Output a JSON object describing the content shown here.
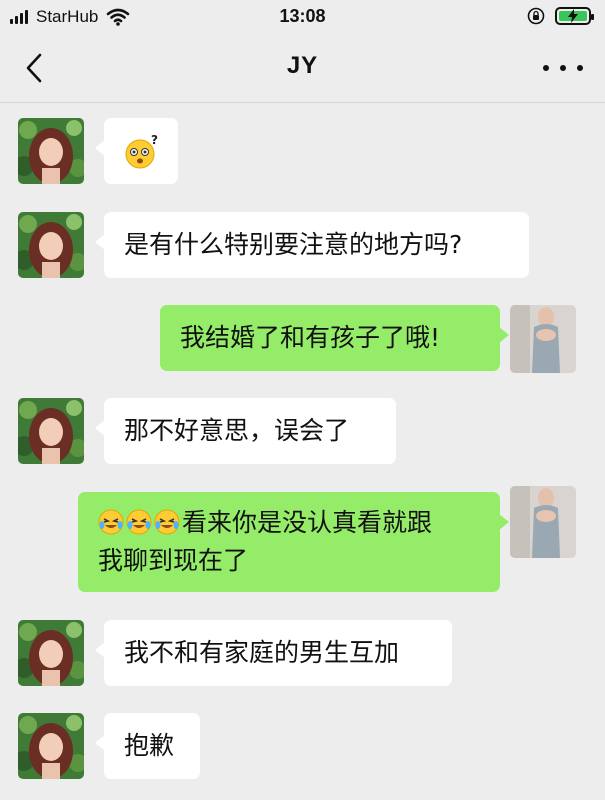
{
  "status_bar": {
    "carrier": "StarHub",
    "time": "13:08",
    "icons": [
      "signal-icon",
      "wifi-icon",
      "orientation-lock-icon",
      "battery-charging-icon"
    ]
  },
  "header": {
    "title": "JY",
    "back_icon": "chevron-left-icon",
    "more_icon": "more-dots-icon"
  },
  "messages": [
    {
      "side": "left",
      "sender": "JY",
      "content": "",
      "emoji": [
        "flushed-question-emoji"
      ]
    },
    {
      "side": "left",
      "sender": "JY",
      "content": "是有什么特别要注意的地方吗?"
    },
    {
      "side": "right",
      "sender": "me",
      "content": "我结婚了和有孩子了哦!"
    },
    {
      "side": "left",
      "sender": "JY",
      "content": "那不好意思，误会了"
    },
    {
      "side": "right",
      "sender": "me",
      "emoji": [
        "crying-laughing-emoji",
        "crying-laughing-emoji",
        "crying-laughing-emoji"
      ],
      "content_line1": "看来你是没认真看就跟",
      "content_line2": "我聊到现在了"
    },
    {
      "side": "left",
      "sender": "JY",
      "content": "我不和有家庭的男生互加"
    },
    {
      "side": "left",
      "sender": "JY",
      "content": "抱歉"
    }
  ],
  "colors": {
    "background": "#ededed",
    "bubble_left": "#ffffff",
    "bubble_right": "#95ec69",
    "battery": "#38c659"
  }
}
